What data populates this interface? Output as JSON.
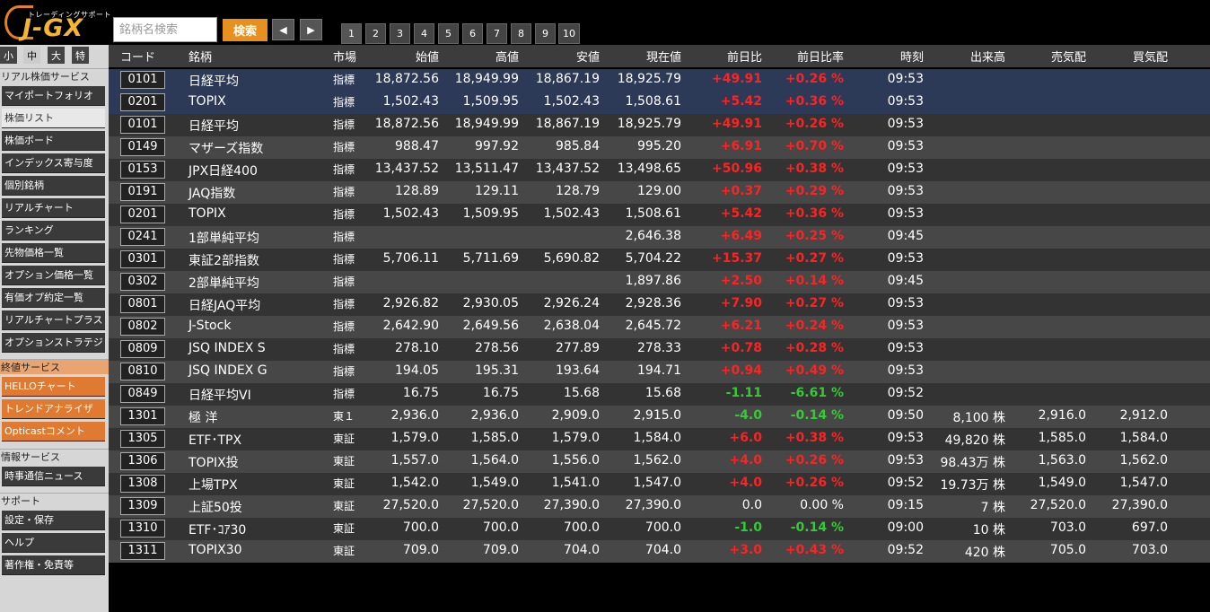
{
  "logo": {
    "sub": "トレーディングサポート",
    "main": "J-GX"
  },
  "search": {
    "placeholder": "銘柄名検索",
    "button": "検索"
  },
  "nav": {
    "prev": "◀",
    "next": "▶"
  },
  "pages": [
    "1",
    "2",
    "3",
    "4",
    "5",
    "6",
    "7",
    "8",
    "9",
    "10"
  ],
  "sidebar": {
    "sizes": [
      "小",
      "中",
      "大",
      "特"
    ],
    "sections": [
      {
        "title": "リアル株価サービス",
        "items": [
          "マイポートフォリオ",
          "株価リスト",
          "株価ボード",
          "インデックス寄与度",
          "個別銘柄",
          "リアルチャート",
          "ランキング",
          "先物価格一覧",
          "オプション価格一覧",
          "有価オプ約定一覧",
          "リアルチャートプラス",
          "オプションストラテジ"
        ]
      },
      {
        "title": "終値サービス",
        "items": [
          "HELLOチャート",
          "トレンドアナライザ",
          "Opticastコメント"
        ]
      },
      {
        "title": "情報サービス",
        "items": [
          "時事通信ニュース"
        ]
      },
      {
        "title": "サポート",
        "items": [
          "設定・保存",
          "ヘルプ",
          "著作権・免責等"
        ]
      }
    ]
  },
  "table": {
    "headers": [
      "コード",
      "銘柄",
      "市場",
      "始値",
      "高値",
      "安値",
      "現在値",
      "前日比",
      "前日比率",
      "時刻",
      "出来高",
      "売気配",
      "買気配"
    ],
    "rows": [
      [
        "0101",
        "日経平均",
        "指標",
        "18,872.56",
        "18,949.99",
        "18,867.19",
        "18,925.79",
        "+49.91",
        "+0.26 %",
        "09:53",
        "",
        "",
        ""
      ],
      [
        "0201",
        "TOPIX",
        "指標",
        "1,502.43",
        "1,509.95",
        "1,502.43",
        "1,508.61",
        "+5.42",
        "+0.36 %",
        "09:53",
        "",
        "",
        ""
      ],
      [
        "0101",
        "日経平均",
        "指標",
        "18,872.56",
        "18,949.99",
        "18,867.19",
        "18,925.79",
        "+49.91",
        "+0.26 %",
        "09:53",
        "",
        "",
        ""
      ],
      [
        "0149",
        "マザーズ指数",
        "指標",
        "988.47",
        "997.92",
        "985.84",
        "995.20",
        "+6.91",
        "+0.70 %",
        "09:53",
        "",
        "",
        ""
      ],
      [
        "0153",
        "JPX日経400",
        "指標",
        "13,437.52",
        "13,511.47",
        "13,437.52",
        "13,498.65",
        "+50.96",
        "+0.38 %",
        "09:53",
        "",
        "",
        ""
      ],
      [
        "0191",
        "JAQ指数",
        "指標",
        "128.89",
        "129.11",
        "128.79",
        "129.00",
        "+0.37",
        "+0.29 %",
        "09:53",
        "",
        "",
        ""
      ],
      [
        "0201",
        "TOPIX",
        "指標",
        "1,502.43",
        "1,509.95",
        "1,502.43",
        "1,508.61",
        "+5.42",
        "+0.36 %",
        "09:53",
        "",
        "",
        ""
      ],
      [
        "0241",
        "1部単純平均",
        "指標",
        "",
        "",
        "",
        "2,646.38",
        "+6.49",
        "+0.25 %",
        "09:45",
        "",
        "",
        ""
      ],
      [
        "0301",
        "東証2部指数",
        "指標",
        "5,706.11",
        "5,711.69",
        "5,690.82",
        "5,704.22",
        "+15.37",
        "+0.27 %",
        "09:53",
        "",
        "",
        ""
      ],
      [
        "0302",
        "2部単純平均",
        "指標",
        "",
        "",
        "",
        "1,897.86",
        "+2.50",
        "+0.14 %",
        "09:45",
        "",
        "",
        ""
      ],
      [
        "0801",
        "日経JAQ平均",
        "指標",
        "2,926.82",
        "2,930.05",
        "2,926.24",
        "2,928.36",
        "+7.90",
        "+0.27 %",
        "09:53",
        "",
        "",
        ""
      ],
      [
        "0802",
        "J-Stock",
        "指標",
        "2,642.90",
        "2,649.56",
        "2,638.04",
        "2,645.72",
        "+6.21",
        "+0.24 %",
        "09:53",
        "",
        "",
        ""
      ],
      [
        "0809",
        "JSQ INDEX S",
        "指標",
        "278.10",
        "278.56",
        "277.89",
        "278.33",
        "+0.78",
        "+0.28 %",
        "09:53",
        "",
        "",
        ""
      ],
      [
        "0810",
        "JSQ INDEX G",
        "指標",
        "194.05",
        "195.31",
        "193.64",
        "194.71",
        "+0.94",
        "+0.49 %",
        "09:53",
        "",
        "",
        ""
      ],
      [
        "0849",
        "日経平均VI",
        "指標",
        "16.75",
        "16.75",
        "15.68",
        "15.68",
        "-1.11",
        "-6.61 %",
        "09:52",
        "",
        "",
        ""
      ],
      [
        "1301",
        "極 洋",
        "東１",
        "2,936.0",
        "2,936.0",
        "2,909.0",
        "2,915.0",
        "-4.0",
        "-0.14 %",
        "09:50",
        "8,100 株",
        "2,916.0",
        "2,912.0"
      ],
      [
        "1305",
        "ETF･TPX",
        "東証",
        "1,579.0",
        "1,585.0",
        "1,579.0",
        "1,584.0",
        "+6.0",
        "+0.38 %",
        "09:53",
        "49,820 株",
        "1,585.0",
        "1,584.0"
      ],
      [
        "1306",
        "TOPIX投",
        "東証",
        "1,557.0",
        "1,564.0",
        "1,556.0",
        "1,562.0",
        "+4.0",
        "+0.26 %",
        "09:53",
        "98.43万 株",
        "1,563.0",
        "1,562.0"
      ],
      [
        "1308",
        "上場TPX",
        "東証",
        "1,542.0",
        "1,549.0",
        "1,541.0",
        "1,547.0",
        "+4.0",
        "+0.26 %",
        "09:52",
        "19.73万 株",
        "1,549.0",
        "1,547.0"
      ],
      [
        "1309",
        "上証50投",
        "東証",
        "27,520.0",
        "27,520.0",
        "27,390.0",
        "27,390.0",
        "0.0",
        "0.00 %",
        "09:15",
        "7 株",
        "27,520.0",
        "27,390.0"
      ],
      [
        "1310",
        "ETF･ｺｱ30",
        "東証",
        "700.0",
        "700.0",
        "700.0",
        "700.0",
        "-1.0",
        "-0.14 %",
        "09:00",
        "10 株",
        "703.0",
        "697.0"
      ],
      [
        "1311",
        "TOPIX30",
        "東証",
        "709.0",
        "709.0",
        "704.0",
        "704.0",
        "+3.0",
        "+0.43 %",
        "09:52",
        "420 株",
        "705.0",
        "703.0"
      ]
    ]
  },
  "colors": {
    "up": "#ff2222",
    "down": "#33cc33",
    "accent": "#e8901f"
  }
}
